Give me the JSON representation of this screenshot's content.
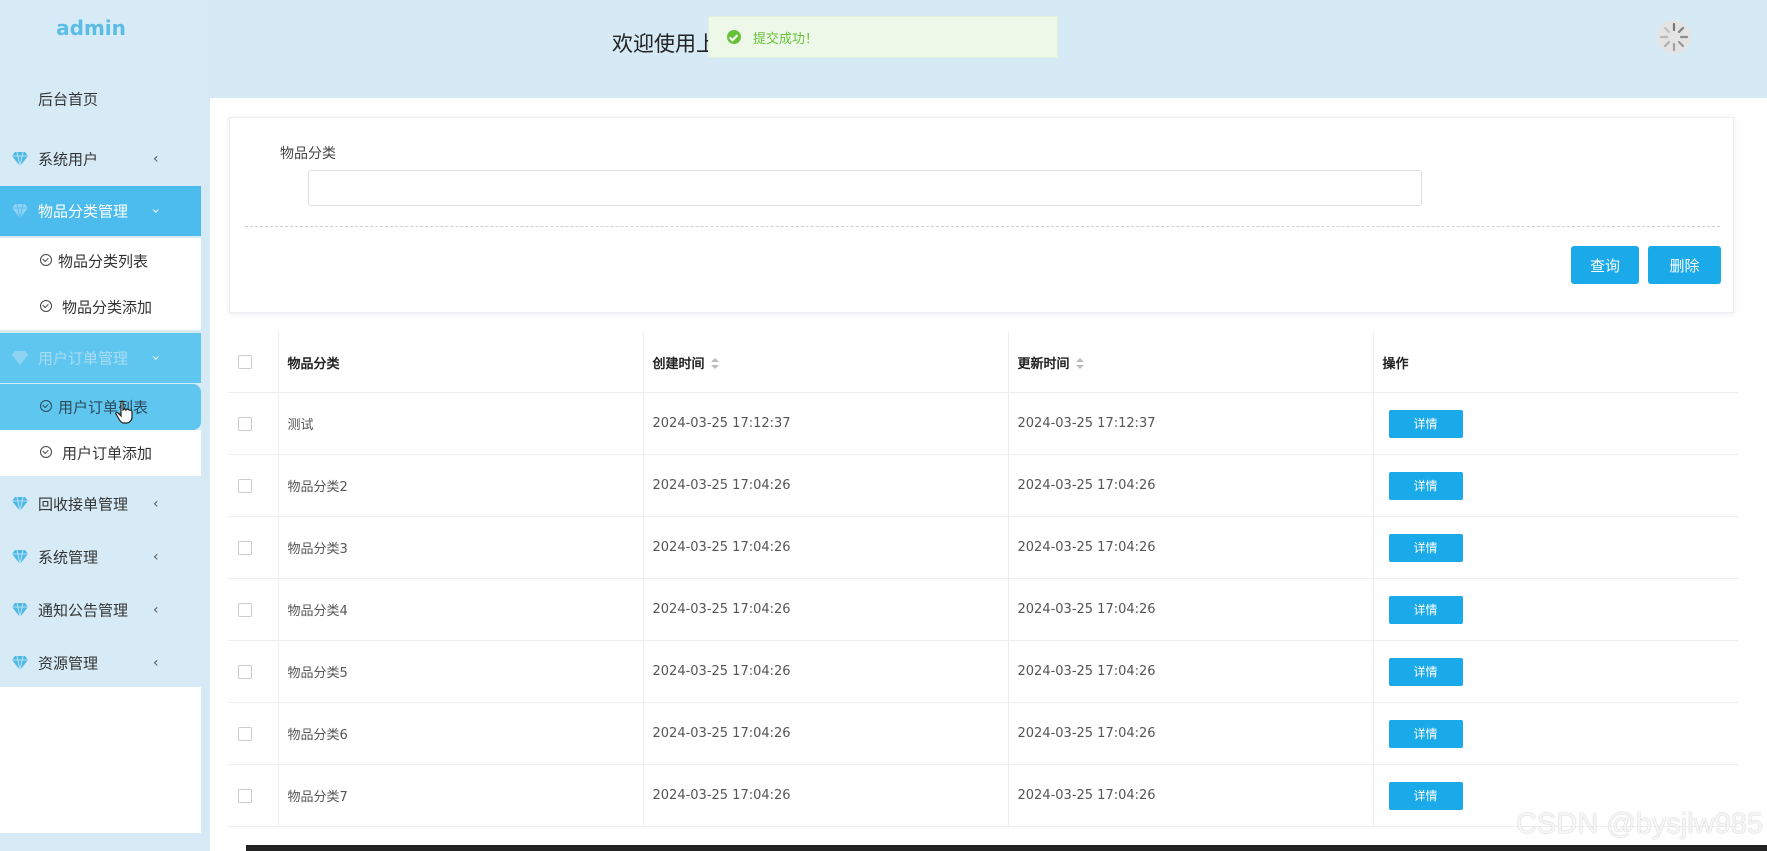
{
  "sidebar": {
    "logo": "admin",
    "home": "后台首页",
    "menus": [
      {
        "label": "系统用户",
        "state": "collapsed"
      },
      {
        "label": "物品分类管理",
        "state": "expanded",
        "children": [
          "物品分类列表",
          "物品分类添加"
        ]
      },
      {
        "label": "用户订单管理",
        "state": "expanded",
        "children": [
          "用户订单列表",
          "用户订单添加"
        ]
      },
      {
        "label": "回收接单管理",
        "state": "collapsed"
      },
      {
        "label": "系统管理",
        "state": "collapsed"
      },
      {
        "label": "通知公告管理",
        "state": "collapsed"
      },
      {
        "label": "资源管理",
        "state": "collapsed"
      }
    ]
  },
  "header": {
    "welcome": "欢迎使用上",
    "toast": "提交成功！"
  },
  "search": {
    "label": "物品分类",
    "value": "",
    "query_label": "查询",
    "delete_label": "删除"
  },
  "table": {
    "headers": [
      "物品分类",
      "创建时间",
      "更新时间",
      "操作"
    ],
    "action_label": "详情",
    "rows": [
      {
        "name": "测试",
        "created": "2024-03-25 17:12:37",
        "updated": "2024-03-25 17:12:37"
      },
      {
        "name": "物品分类2",
        "created": "2024-03-25 17:04:26",
        "updated": "2024-03-25 17:04:26"
      },
      {
        "name": "物品分类3",
        "created": "2024-03-25 17:04:26",
        "updated": "2024-03-25 17:04:26"
      },
      {
        "name": "物品分类4",
        "created": "2024-03-25 17:04:26",
        "updated": "2024-03-25 17:04:26"
      },
      {
        "name": "物品分类5",
        "created": "2024-03-25 17:04:26",
        "updated": "2024-03-25 17:04:26"
      },
      {
        "name": "物品分类6",
        "created": "2024-03-25 17:04:26",
        "updated": "2024-03-25 17:04:26"
      },
      {
        "name": "物品分类7",
        "created": "2024-03-25 17:04:26",
        "updated": "2024-03-25 17:04:26"
      }
    ]
  },
  "watermark": "CSDN @bysjlw985",
  "colors": {
    "accent": "#1aa9e9",
    "sidebar_active": "#4cbcee",
    "success": "#67c23a",
    "background": "#d6eaf6"
  }
}
